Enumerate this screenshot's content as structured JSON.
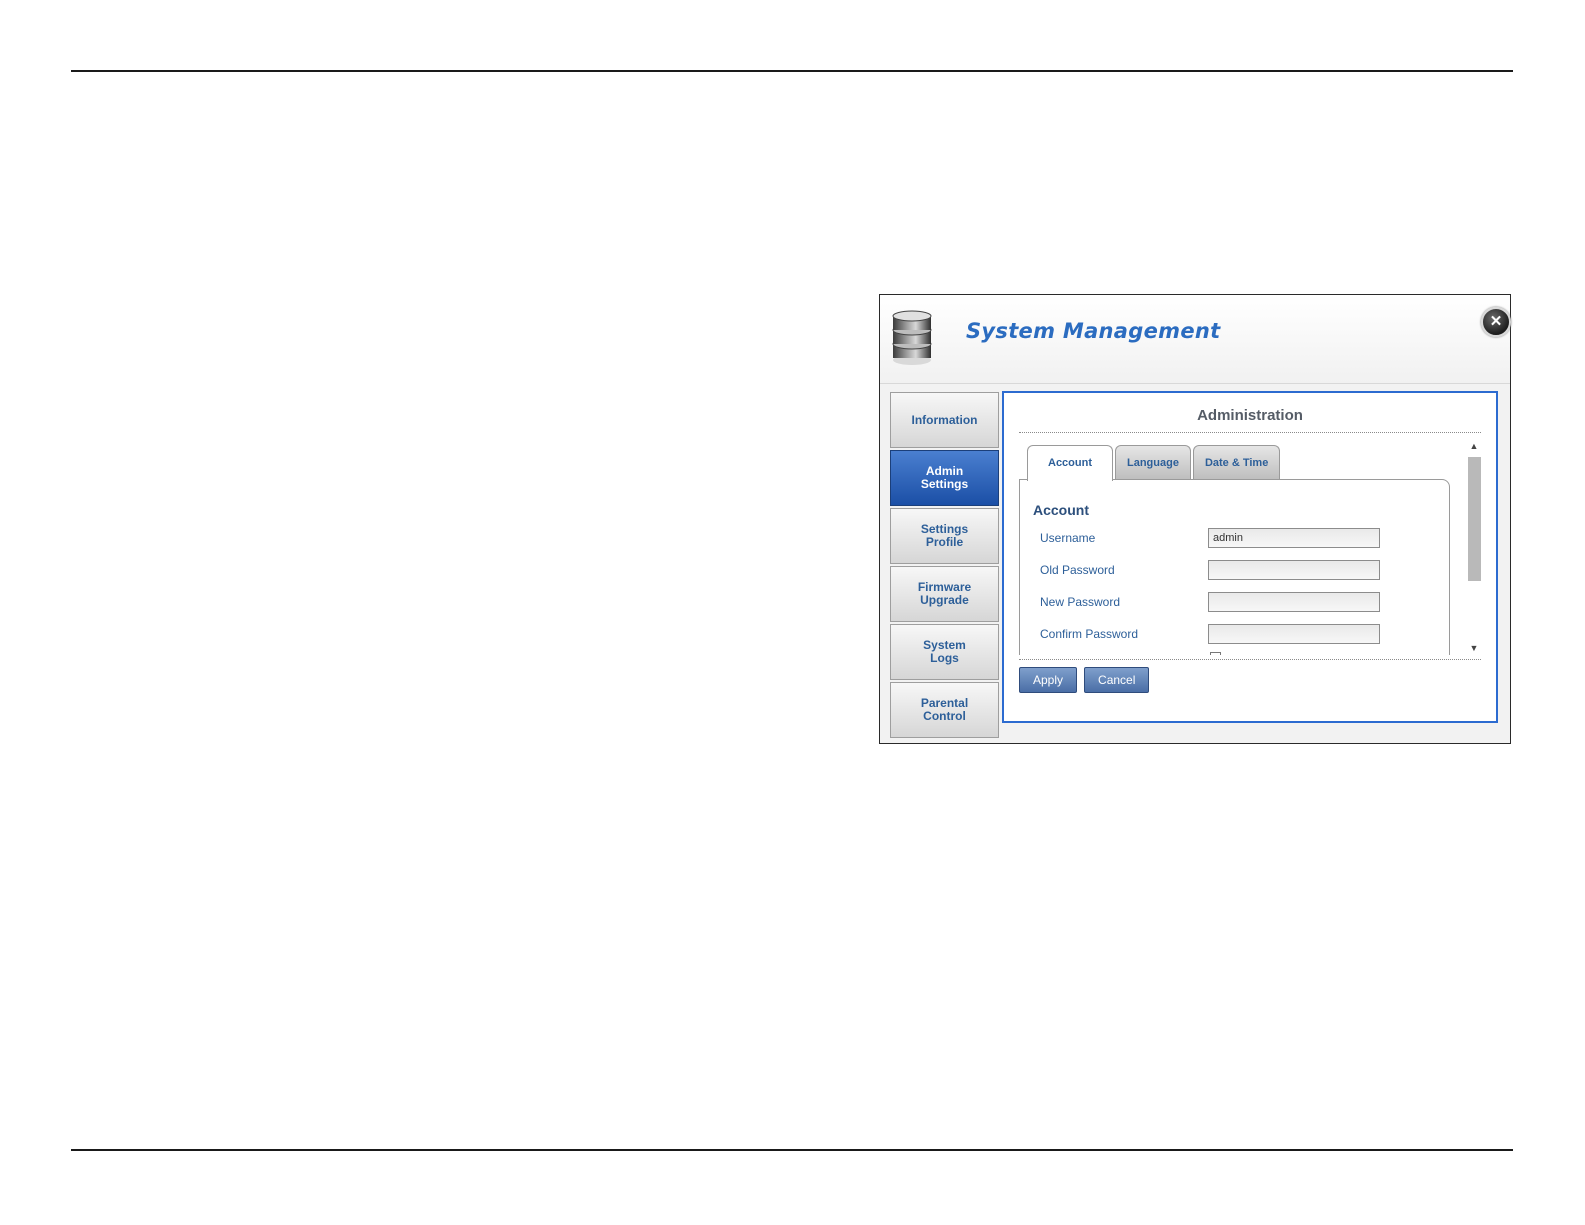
{
  "window": {
    "title": "System Management",
    "icon": "database-icon",
    "close_icon": "close-icon"
  },
  "sidebar": {
    "items": [
      {
        "label": "Information",
        "active": false
      },
      {
        "label": "Admin\nSettings",
        "active": true
      },
      {
        "label": "Settings\nProfile",
        "active": false
      },
      {
        "label": "Firmware\nUpgrade",
        "active": false
      },
      {
        "label": "System\nLogs",
        "active": false
      },
      {
        "label": "Parental\nControl",
        "active": false
      }
    ]
  },
  "main": {
    "title": "Administration",
    "tabs": [
      {
        "label": "Account",
        "active": true
      },
      {
        "label": "Language",
        "active": false
      },
      {
        "label": "Date & Time",
        "active": false
      }
    ],
    "section_title": "Account",
    "fields": [
      {
        "label": "Username",
        "value": "admin",
        "placeholder": ""
      },
      {
        "label": "Old Password",
        "value": "",
        "placeholder": ""
      },
      {
        "label": "New Password",
        "value": "",
        "placeholder": ""
      },
      {
        "label": "Confirm Password",
        "value": "",
        "placeholder": ""
      }
    ],
    "buttons": {
      "apply": "Apply",
      "cancel": "Cancel"
    }
  },
  "colors": {
    "accent": "#2b6cc0",
    "active_nav": "#1b4fa6",
    "panel_border": "#2c6bd0",
    "button": "#4a6ea6"
  }
}
